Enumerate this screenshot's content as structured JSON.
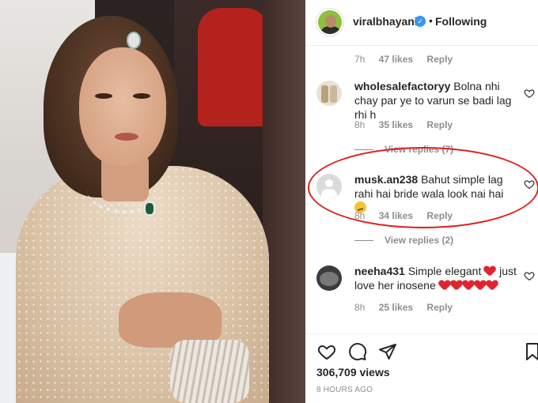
{
  "post": {
    "username": "viralbhayani",
    "follow_label": "Following",
    "separator": "•"
  },
  "top_meta": {
    "time": "7h",
    "likes": "47 likes",
    "reply": "Reply"
  },
  "comments": [
    {
      "user": "wholesalefactoryy",
      "text": "Bolna nhi chay par ye to varun se badi lag rhi h",
      "time": "8h",
      "likes": "35 likes",
      "reply": "Reply",
      "replies": "View replies (7)"
    },
    {
      "user": "musk.an238",
      "text": "Bahut simple lag rahi hai bride wala look nai hai",
      "time": "8h",
      "likes": "34 likes",
      "reply": "Reply",
      "replies": "View replies (2)"
    },
    {
      "user": "neeha431",
      "text_a": "Simple elegant",
      "text_b": "just love her inosene",
      "time": "8h",
      "likes": "25 likes",
      "reply": "Reply"
    }
  ],
  "views": "306,709 views",
  "time_ago": "8 HOURS AGO",
  "icons": [
    "verified-badge-icon",
    "heart-icon",
    "comment-icon",
    "share-icon",
    "bookmark-icon"
  ],
  "colors": {
    "accent": "#3897f0",
    "annotation_circle": "#e11d1d",
    "heart_emoji": "#e0242f"
  }
}
